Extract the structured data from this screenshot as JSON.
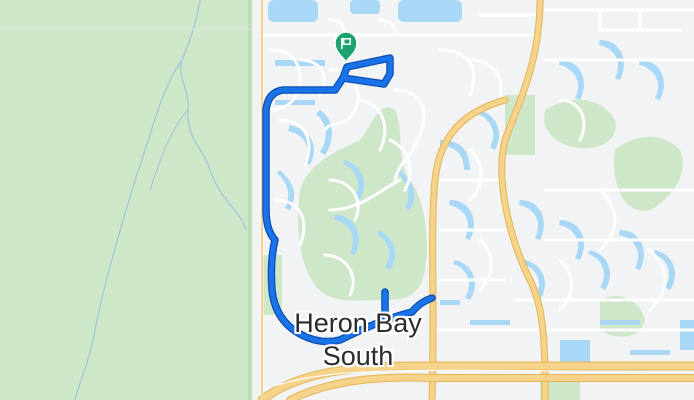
{
  "map": {
    "area_label_line1": "Heron Bay",
    "area_label_line2": "South",
    "marker_icon": "flag-pin-icon",
    "colors": {
      "background": "#f1f3f4",
      "park": "#cde7c8",
      "water": "#a8d8f5",
      "street": "#ffffff",
      "highway": "#f5d38a",
      "highway_edge": "#e4b457",
      "route": "#1a73e8",
      "route_outline": "#0b4fb3",
      "marker": "#1aa36f"
    }
  }
}
